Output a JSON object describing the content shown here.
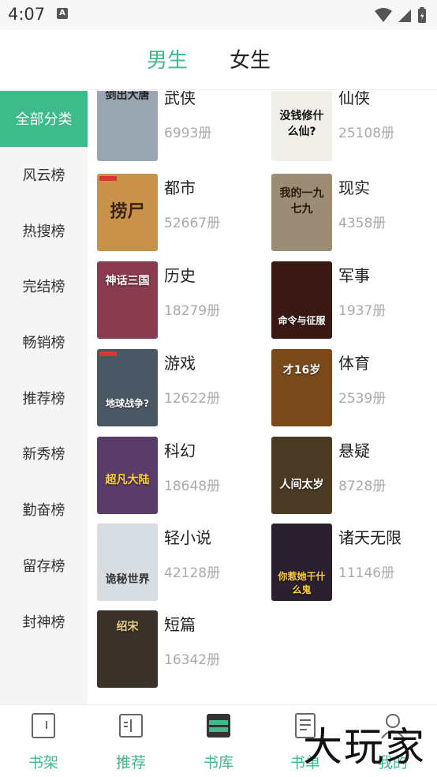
{
  "status_bar": {
    "time": "4:07",
    "notif_letter": "A"
  },
  "gender_tabs": [
    {
      "label": "男生",
      "active": true
    },
    {
      "label": "女生",
      "active": false
    }
  ],
  "sidebar": {
    "items": [
      {
        "label": "全部分类",
        "active": true
      },
      {
        "label": "风云榜"
      },
      {
        "label": "热搜榜"
      },
      {
        "label": "完结榜"
      },
      {
        "label": "畅销榜"
      },
      {
        "label": "推荐榜"
      },
      {
        "label": "新秀榜"
      },
      {
        "label": "勤奋榜"
      },
      {
        "label": "留存榜"
      },
      {
        "label": "封神榜"
      }
    ]
  },
  "categories": [
    {
      "name": "武侠",
      "count": "6993册",
      "cover_text": "剑出大唐",
      "cover_color": "#9aa7b3"
    },
    {
      "name": "仙侠",
      "count": "25108册",
      "cover_text": "没钱修什么仙?",
      "cover_color": "#f1efe9"
    },
    {
      "name": "都市",
      "count": "52667册",
      "cover_text": "捞尸",
      "cover_color": "#c8924a"
    },
    {
      "name": "现实",
      "count": "4358册",
      "cover_text": "我的一九七九",
      "cover_color": "#9b8d75"
    },
    {
      "name": "历史",
      "count": "18279册",
      "cover_text": "神话三国",
      "cover_color": "#8a3b4f"
    },
    {
      "name": "军事",
      "count": "1937册",
      "cover_text": "命令与征服",
      "cover_color": "#3a1814"
    },
    {
      "name": "游戏",
      "count": "12622册",
      "cover_text": "地球战争?",
      "cover_color": "#4a5865"
    },
    {
      "name": "体育",
      "count": "2539册",
      "cover_text": "才16岁",
      "cover_color": "#7a4a1c"
    },
    {
      "name": "科幻",
      "count": "18648册",
      "cover_text": "超凡大陆",
      "cover_color": "#5a3c6a"
    },
    {
      "name": "悬疑",
      "count": "8728册",
      "cover_text": "人间太岁",
      "cover_color": "#4a3a24"
    },
    {
      "name": "轻小说",
      "count": "42128册",
      "cover_text": "诡秘世界",
      "cover_color": "#d8dde2"
    },
    {
      "name": "诸天无限",
      "count": "11146册",
      "cover_text": "你惹她干什么鬼",
      "cover_color": "#2a2030"
    },
    {
      "name": "短篇",
      "count": "16342册",
      "cover_text": "绍宋",
      "cover_color": "#3a3228"
    }
  ],
  "bottom_nav": [
    {
      "label": "书架",
      "icon": "bookshelf-icon"
    },
    {
      "label": "推荐",
      "icon": "open-book-icon"
    },
    {
      "label": "书库",
      "icon": "library-icon",
      "active": true
    },
    {
      "label": "书单",
      "icon": "notebook-icon"
    },
    {
      "label": "我的",
      "icon": "profile-icon"
    }
  ],
  "watermark": "大玩家",
  "colors": {
    "accent": "#3dbb8a",
    "sidebar_bg": "#f6f5f6",
    "count_text": "#aaaaaa"
  }
}
